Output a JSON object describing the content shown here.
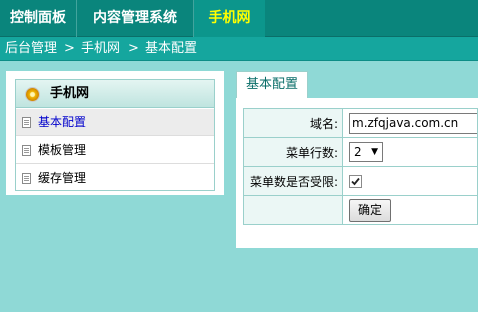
{
  "topnav": {
    "tabs": [
      {
        "label": "控制面板"
      },
      {
        "label": "内容管理系统"
      },
      {
        "label": "手机网",
        "active": true
      }
    ],
    "active_color": "#ffff00"
  },
  "breadcrumb": {
    "items": [
      "后台管理",
      "手机网",
      "基本配置"
    ],
    "separator": ">"
  },
  "sidebar": {
    "title": "手机网",
    "items": [
      {
        "label": "基本配置",
        "active": true
      },
      {
        "label": "模板管理"
      },
      {
        "label": "缓存管理"
      }
    ]
  },
  "main": {
    "tab": "基本配置",
    "form": {
      "domain_label": "域名:",
      "domain_value": "m.zfqjava.com.cn",
      "rows_label": "菜单行数:",
      "rows_value": "2",
      "limit_label": "菜单数是否受限:",
      "limit_checked": true,
      "submit_label": "确定"
    }
  },
  "colors": {
    "nav_bg": "#0a857c",
    "breadcrumb_bg": "#15a69e",
    "page_bg": "#8fd9d6",
    "border": "#9ad0cb"
  }
}
